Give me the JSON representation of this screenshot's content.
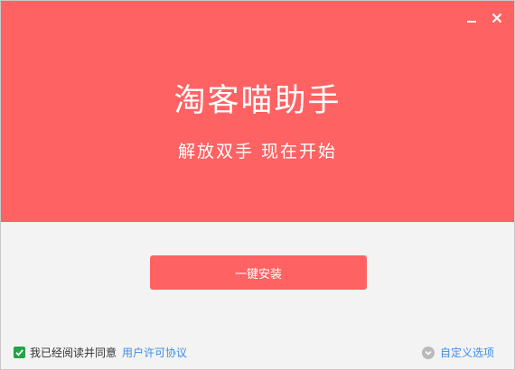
{
  "app": {
    "title": "淘客喵助手",
    "subtitle": "解放双手 现在开始"
  },
  "window_controls": {
    "minimize_icon": "minimize-icon",
    "close_icon": "close-icon"
  },
  "install": {
    "label": "一键安装"
  },
  "footer": {
    "agree_checked": true,
    "agree_text": "我已经阅读并同意",
    "license_link": "用户许可协议",
    "custom_options": "自定义选项"
  },
  "colors": {
    "brand": "#ff6263",
    "checkbox": "#24a34a",
    "link": "#3a8ee6",
    "background": "#f4f3f3"
  }
}
